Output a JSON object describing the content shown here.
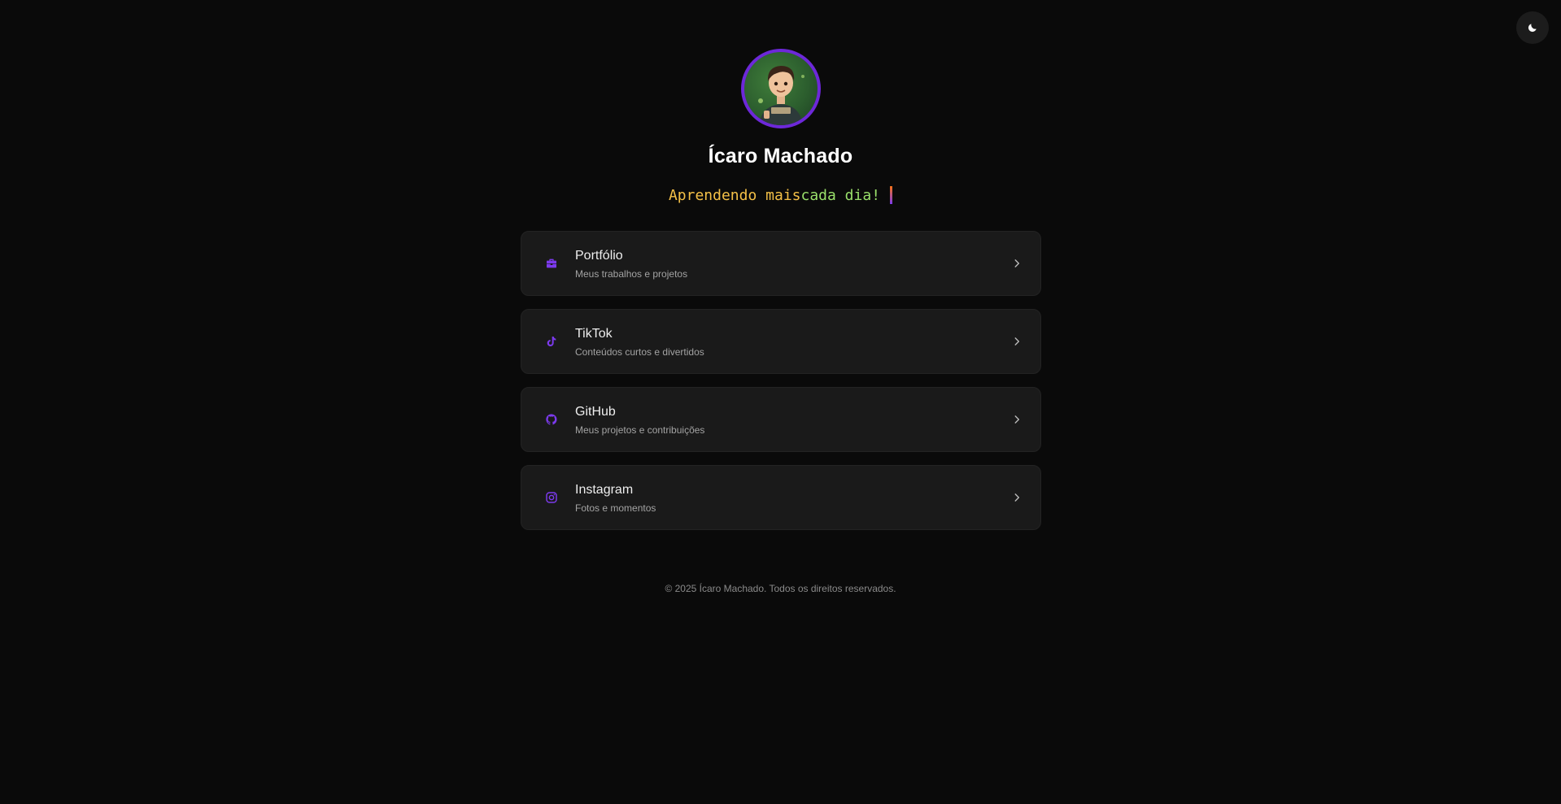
{
  "profile": {
    "name": "Ícaro Machado",
    "tagline_part1": "Aprendendo mais ",
    "tagline_part2": "cada dia!"
  },
  "links": [
    {
      "title": "Portfólio",
      "subtitle": "Meus trabalhos e projetos",
      "icon": "briefcase-icon"
    },
    {
      "title": "TikTok",
      "subtitle": "Conteúdos curtos e divertidos",
      "icon": "tiktok-icon"
    },
    {
      "title": "GitHub",
      "subtitle": "Meus projetos e contribuições",
      "icon": "github-icon"
    },
    {
      "title": "Instagram",
      "subtitle": "Fotos e momentos",
      "icon": "instagram-icon"
    }
  ],
  "footer": {
    "text": "© 2025 Ícaro Machado. Todos os direitos reservados."
  },
  "colors": {
    "background": "#0a0a0a",
    "card": "#1a1a1a",
    "accent": "#7c3aed",
    "tagline_yellow": "#f4c047",
    "tagline_green": "#9ae06b"
  }
}
